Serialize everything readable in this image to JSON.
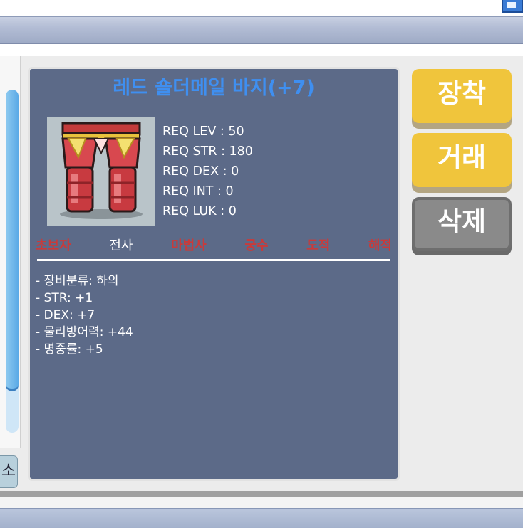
{
  "item": {
    "title": "레드 숄더메일 바지(+7)",
    "requirements": [
      "REQ LEV : 50",
      "REQ STR : 180",
      "REQ DEX : 0",
      "REQ INT : 0",
      "REQ LUK : 0"
    ],
    "jobs": [
      {
        "label": "초보자",
        "enabled": false
      },
      {
        "label": "전사",
        "enabled": true
      },
      {
        "label": "마법사",
        "enabled": false
      },
      {
        "label": "궁수",
        "enabled": false
      },
      {
        "label": "도적",
        "enabled": false
      },
      {
        "label": "해적",
        "enabled": false
      }
    ],
    "stats": [
      "- 장비분류: 하의",
      "- STR: +1",
      "- DEX: +7",
      "- 물리방어력: +44",
      "- 명중률: +5"
    ]
  },
  "buttons": {
    "equip": "장착",
    "trade": "거래",
    "delete": "삭제"
  },
  "left": {
    "small_button": "소"
  },
  "colors": {
    "panel": "#5c6a88",
    "title": "#3f8ff0",
    "disabled_job": "#c93a3a",
    "button_yellow": "#f0c53c",
    "button_gray": "#8a8a8a"
  }
}
